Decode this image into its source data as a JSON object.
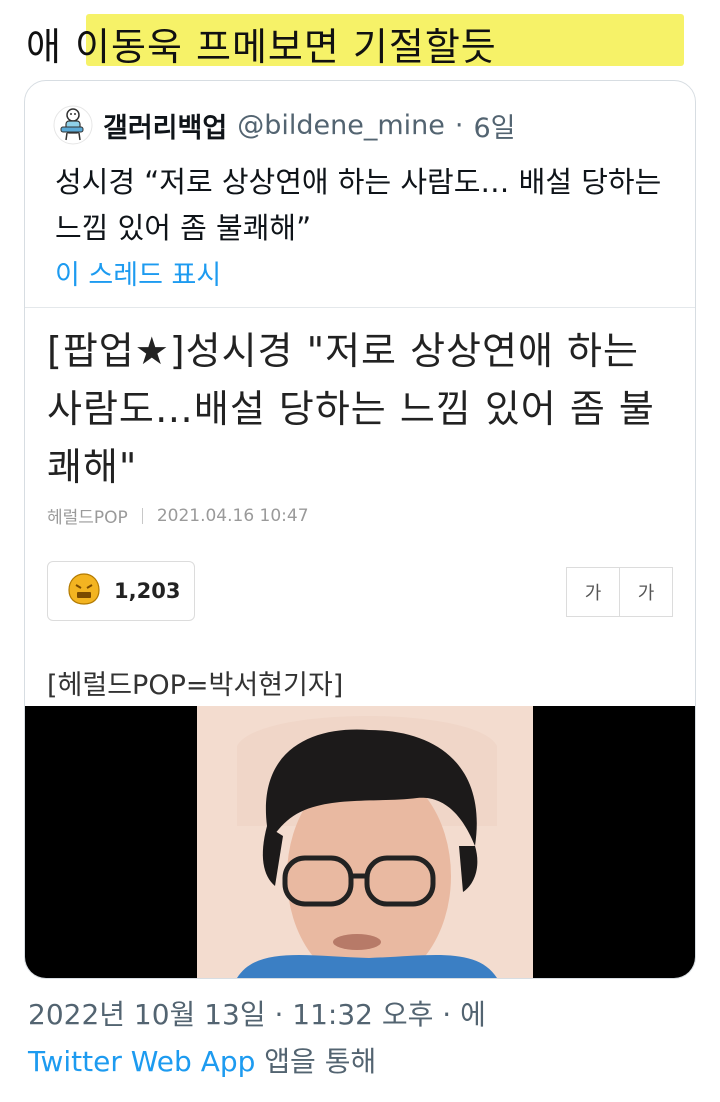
{
  "comment": {
    "text": "애 이동욱 프메보면 기절할듯"
  },
  "quoted_tweet": {
    "display_name": "갤러리백업",
    "handle": "@bildene_mine",
    "separator": "·",
    "time": "6일",
    "body": "성시경 “저로 상상연애 하는 사람도… 배설 당하는 느낌 있어 좀 불쾌해”",
    "thread_link": "이 스레드 표시",
    "avatar_icon": "robot-guitar-avatar-icon"
  },
  "article": {
    "title": "[팝업★]성시경 \"저로 상상연애 하는 사람도…배설 당하는 느낌 있어 좀 불쾌해\"",
    "source": "헤럴드POP",
    "datetime": "2021.04.16 10:47",
    "reaction_count": "1,203",
    "reaction_icon": "angry-face-icon",
    "font_small": "가",
    "font_large": "가",
    "byline": "[헤럴드POP=박서현기자]"
  },
  "footer": {
    "timestamp": "2022년 10월 13일 · 11:32 오후 · 에",
    "app": "Twitter Web App",
    "via": " 앱을 통해"
  },
  "colors": {
    "link": "#1d9bf0",
    "highlight": "#f5f04d",
    "muted": "#536471"
  }
}
